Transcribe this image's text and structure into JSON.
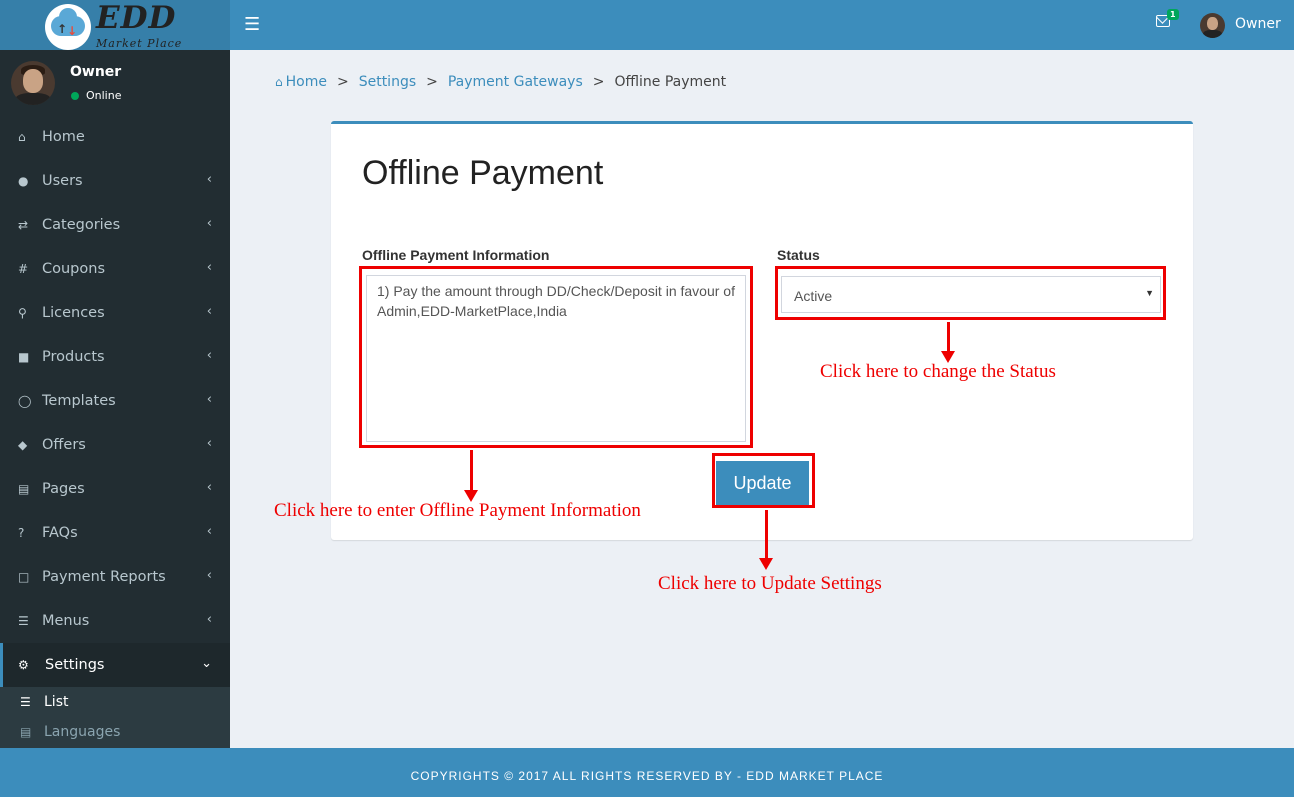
{
  "logo": {
    "title": "EDD",
    "subtitle": "Market Place"
  },
  "user": {
    "name": "Owner",
    "status": "Online"
  },
  "header": {
    "mail_count": "1",
    "user_name": "Owner",
    "menu_icon": "hamburger-icon"
  },
  "sidebar": {
    "items": [
      {
        "label": "Home",
        "icon": "home-icon"
      },
      {
        "label": "Users",
        "icon": "users-icon"
      },
      {
        "label": "Categories",
        "icon": "shuffle-icon"
      },
      {
        "label": "Coupons",
        "icon": "hash-icon"
      },
      {
        "label": "Licences",
        "icon": "key-icon"
      },
      {
        "label": "Products",
        "icon": "bag-icon"
      },
      {
        "label": "Templates",
        "icon": "comment-icon"
      },
      {
        "label": "Offers",
        "icon": "tags-icon"
      },
      {
        "label": "Pages",
        "icon": "file-icon"
      },
      {
        "label": "FAQs",
        "icon": "question-icon"
      },
      {
        "label": "Payment Reports",
        "icon": "document-icon"
      },
      {
        "label": "Menus",
        "icon": "bars-icon"
      },
      {
        "label": "Settings",
        "icon": "gear-icon"
      }
    ],
    "sub_items": [
      {
        "label": "List",
        "icon": "list-icon"
      },
      {
        "label": "Languages",
        "icon": "language-icon"
      }
    ]
  },
  "breadcrumb": {
    "home": "Home",
    "settings": "Settings",
    "gateways": "Payment Gateways",
    "current": "Offline Payment",
    "separator": ">"
  },
  "form": {
    "title": "Offline Payment",
    "info_label": "Offline Payment Information",
    "info_value": "1) Pay the amount through DD/Check/Deposit in favour of Admin,EDD-MarketPlace,India",
    "status_label": "Status",
    "status_value": "Active",
    "update_label": "Update"
  },
  "annotations": {
    "info_note": "Click here to enter Offline Payment Information",
    "status_note": "Click here to change the Status",
    "update_note": "Click here to Update Settings"
  },
  "footer": {
    "text": "COPYRIGHTS © 2017 ALL RIGHTS RESERVED BY - EDD MARKET PLACE"
  },
  "colors": {
    "primary": "#3c8dbc",
    "sidebar": "#222d32",
    "annotation": "#ee0000"
  }
}
